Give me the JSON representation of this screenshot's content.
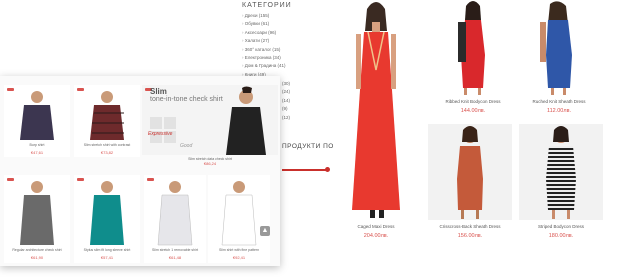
{
  "categories": {
    "title": "КАТЕГОРИИ",
    "items": [
      "Дрехи (155)",
      "Обувки (61)",
      "Аксесоари (96)",
      "Халати (27)",
      "360° каталог (15)",
      "Електроника (34)",
      "Дом & Градина (41)",
      "Книги (49)"
    ],
    "extra_items": [
      "(30)",
      "(24)",
      "(14)",
      "(9)",
      "(12)"
    ]
  },
  "price_filter": {
    "label": "ПРОДУКТИ ПО",
    "accent_color": "#c9302c"
  },
  "dresses": [
    {
      "name": "Caged Maxi Dress",
      "price": "204.00лв.",
      "color": "#e8392f"
    },
    {
      "name": "Ribbed Knit Bodycon Dress",
      "price": "144.00лв.",
      "color": "#d9282c"
    },
    {
      "name": "Ruched Knit Sheath Dress",
      "price": "112.00лв.",
      "color": "#2f57a8"
    },
    {
      "name": "Crisscross-Back Sheath Dress",
      "price": "156.00лв.",
      "color": "#c45a3a"
    },
    {
      "name": "Striped Bodycon Dress",
      "price": "180.00лв.",
      "color": "#2b2b2b"
    }
  ],
  "shirts": [
    {
      "name": "Burp shirt",
      "price": "€47,61",
      "color": "#3c3650"
    },
    {
      "name": "Slim stretch shirt with contrast",
      "price": "€73,82",
      "color": "#6e2a2c"
    },
    {
      "name": "Slim stretch data check shirt",
      "price": "€86,24",
      "color": "#222222"
    },
    {
      "name": "Regular architecture check shirt",
      "price": "€61,90",
      "color": "#6a6a6a"
    },
    {
      "name": "Stylus slim fit long sleeve shirt",
      "price": "€57,41",
      "color": "#0f8d8c"
    },
    {
      "name": "Slim stretch 1 removable shirt",
      "price": "€61,48",
      "color": "#e6e6ea"
    },
    {
      "name": "Slim shirt with fine pattern",
      "price": "€92,41",
      "color": "#ffffff"
    }
  ],
  "banner": {
    "title": "Slim",
    "subtitle": "tone-in-tone check shirt",
    "brand": "Expressive",
    "sign": "Good"
  },
  "badge_color": "#d9534f",
  "price_color": "#d9534f"
}
